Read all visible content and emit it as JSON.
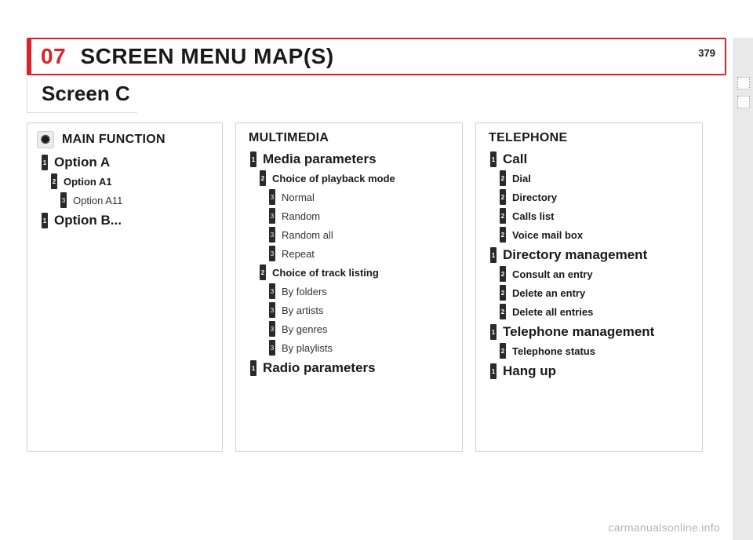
{
  "page_number": "379",
  "chapter_number": "07",
  "page_title": "SCREEN MENU MAP(S)",
  "section_title": "Screen C",
  "watermark": "carmanualsonline.info",
  "main_function": {
    "label": "MAIN FUNCTION",
    "option_a": "Option A",
    "option_a1": "Option A1",
    "option_a11": "Option A11",
    "option_b": "Option B..."
  },
  "multimedia": {
    "label": "MULTIMEDIA",
    "media_params": "Media parameters",
    "choice_playback": "Choice of playback mode",
    "normal": "Normal",
    "random": "Random",
    "random_all": "Random all",
    "repeat": "Repeat",
    "choice_track": "Choice of track listing",
    "by_folders": "By folders",
    "by_artists": "By artists",
    "by_genres": "By genres",
    "by_playlists": "By playlists",
    "radio_params": "Radio parameters"
  },
  "telephone": {
    "label": "TELEPHONE",
    "call": "Call",
    "dial": "Dial",
    "directory": "Directory",
    "calls_list": "Calls list",
    "voice_mail": "Voice mail box",
    "dir_mgmt": "Directory management",
    "consult": "Consult an entry",
    "delete": "Delete an entry",
    "delete_all": "Delete all entries",
    "tel_mgmt": "Telephone management",
    "tel_status": "Telephone status",
    "hang_up": "Hang up"
  }
}
